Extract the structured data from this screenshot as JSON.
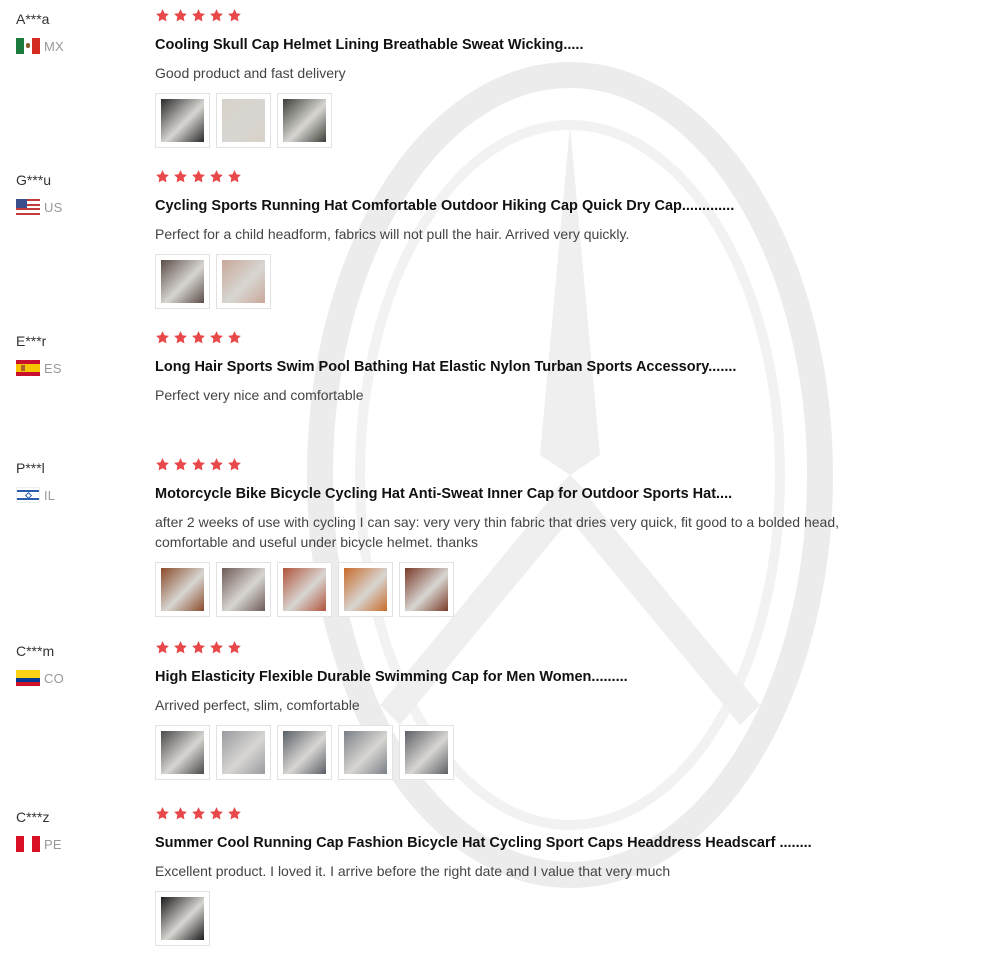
{
  "colors": {
    "star": "#e8484a",
    "muted": "#999999"
  },
  "reviews": [
    {
      "user": "A***a",
      "country": "MX",
      "flag": "mx",
      "rating": 5,
      "title": "Cooling Skull Cap Helmet Lining Breathable Sweat Wicking.....",
      "text": "Good product and fast delivery",
      "photos": [
        "#2a2a2a",
        "#d7d2c8",
        "#3b3f38"
      ]
    },
    {
      "user": "G***u",
      "country": "US",
      "flag": "us",
      "rating": 5,
      "title": "Cycling Sports Running Hat Comfortable Outdoor Hiking Cap Quick Dry Cap.............",
      "text": "Perfect for a child headform, fabrics will not pull the hair. Arrived very quickly.",
      "photos": [
        "#5b4d48",
        "#c9a89a"
      ]
    },
    {
      "user": "E***r",
      "country": "ES",
      "flag": "es",
      "rating": 5,
      "title": "Long Hair Sports Swim Pool Bathing Hat Elastic Nylon Turban Sports Accessory.......",
      "text": "Perfect very nice and comfortable",
      "photos": []
    },
    {
      "user": "P***l",
      "country": "IL",
      "flag": "il",
      "rating": 5,
      "title": "Motorcycle Bike Bicycle Cycling Hat Anti-Sweat Inner Cap for Outdoor Sports Hat....",
      "text": "after 2 weeks of use with cycling I can say: very very thin fabric that dries very quick, fit good to a bolded head, comfortable and useful under bicycle helmet. thanks",
      "photos": [
        "#8a4a2a",
        "#6d5a55",
        "#b0533a",
        "#c86a2a",
        "#7a3a28"
      ]
    },
    {
      "user": "C***m",
      "country": "CO",
      "flag": "co",
      "rating": 5,
      "title": "High Elasticity Flexible Durable Swimming Cap for Men Women.........",
      "text": "Arrived perfect, slim, comfortable",
      "photos": [
        "#4a4a4a",
        "#9a9aa0",
        "#5a6068",
        "#7a8088",
        "#5c6066"
      ]
    },
    {
      "user": "C***z",
      "country": "PE",
      "flag": "pe",
      "rating": 5,
      "title": "Summer Cool Running Cap Fashion Bicycle Hat Cycling Sport Caps Headdress Headscarf ........",
      "text": "Excellent product. I loved it. I arrive before the right date and I value that very much",
      "photos": [
        "#1c1c1c"
      ]
    }
  ]
}
